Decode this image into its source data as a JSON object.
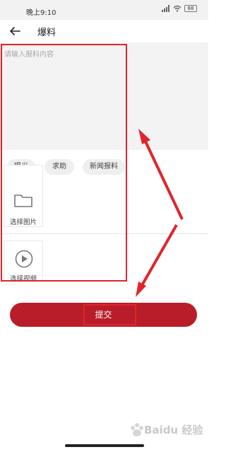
{
  "status_bar": {
    "time": "晚上9:10",
    "signal_icon": "signal-icon",
    "wifi_icon": "wifi-icon",
    "battery_level": "88"
  },
  "header": {
    "back_icon": "arrow-left-icon",
    "title": "爆料"
  },
  "form": {
    "content_placeholder": "请输入报料内容",
    "tags": [
      {
        "label": "曝光"
      },
      {
        "label": "求助"
      },
      {
        "label": "新闻报料"
      }
    ],
    "uploads": [
      {
        "label": "选择图片",
        "icon": "folder-icon"
      },
      {
        "label": "选择视频",
        "icon": "play-icon"
      }
    ],
    "submit_label": "提交"
  },
  "colors": {
    "accent": "#b81d29",
    "annotation": "#e0252c"
  },
  "watermark": {
    "text": "Baidu 经验",
    "icon": "baidu-paw-icon"
  }
}
